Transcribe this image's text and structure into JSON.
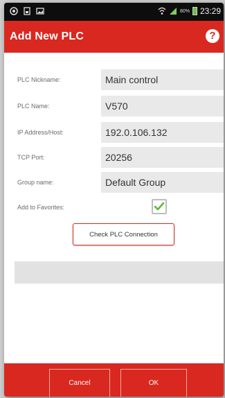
{
  "status_bar": {
    "time": "23:29",
    "battery_percent": "80%",
    "left_icons": [
      "android-icon",
      "notification-icon",
      "image-icon"
    ],
    "right_icons": [
      "wifi-icon",
      "signal-icon",
      "battery-icon"
    ]
  },
  "header": {
    "title": "Add New PLC",
    "help_icon": "?"
  },
  "form": {
    "fields": [
      {
        "label": "PLC Nickname:",
        "value": "Main control"
      },
      {
        "label": "PLC Name:",
        "value": "V570"
      },
      {
        "label": "IP Address/Host:",
        "value": "192.0.106.132"
      },
      {
        "label": "TCP Port:",
        "value": "20256"
      },
      {
        "label": "Group name:",
        "value": "Default Group"
      }
    ],
    "favorites_label": "Add to Favorites:",
    "favorites_checked": true,
    "check_button": "Check PLC Connection",
    "result_text": ""
  },
  "footer": {
    "cancel_label": "Cancel",
    "ok_label": "OK"
  },
  "colors": {
    "accent": "#d9281f",
    "check": "#5cb83a"
  }
}
